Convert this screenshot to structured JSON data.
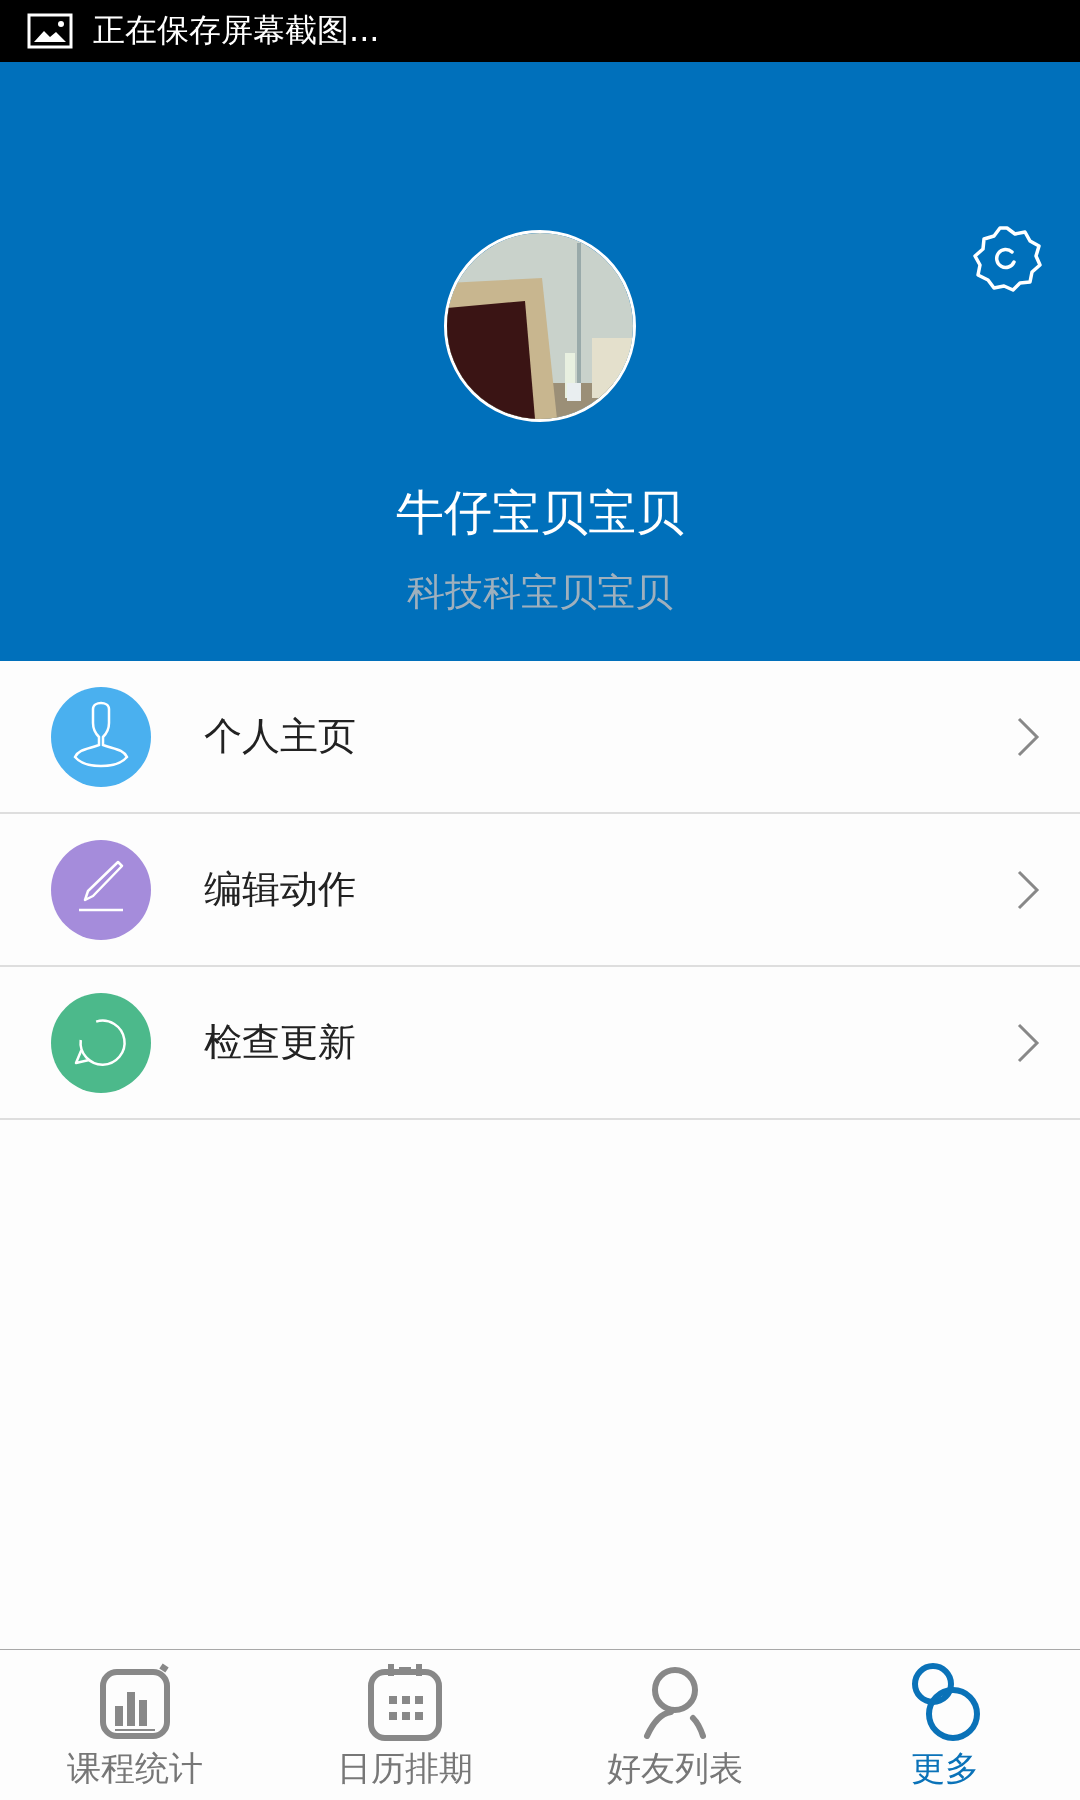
{
  "status_bar": {
    "notification": "正在保存屏幕截图..."
  },
  "profile": {
    "name": "牛仔宝贝宝贝",
    "subtitle": "科技科宝贝宝贝"
  },
  "menu": [
    {
      "kind": "person",
      "label": "个人主页",
      "color": "#4ab0ef"
    },
    {
      "kind": "edit",
      "label": "编辑动作",
      "color": "#a58cdb"
    },
    {
      "kind": "refresh",
      "label": "检查更新",
      "color": "#4cb98b"
    }
  ],
  "tabs": [
    {
      "kind": "chart",
      "label": "课程统计",
      "selected": false
    },
    {
      "kind": "calendar",
      "label": "日历排期",
      "selected": false
    },
    {
      "kind": "person",
      "label": "好友列表",
      "selected": false
    },
    {
      "kind": "more",
      "label": "更多",
      "selected": true
    }
  ]
}
